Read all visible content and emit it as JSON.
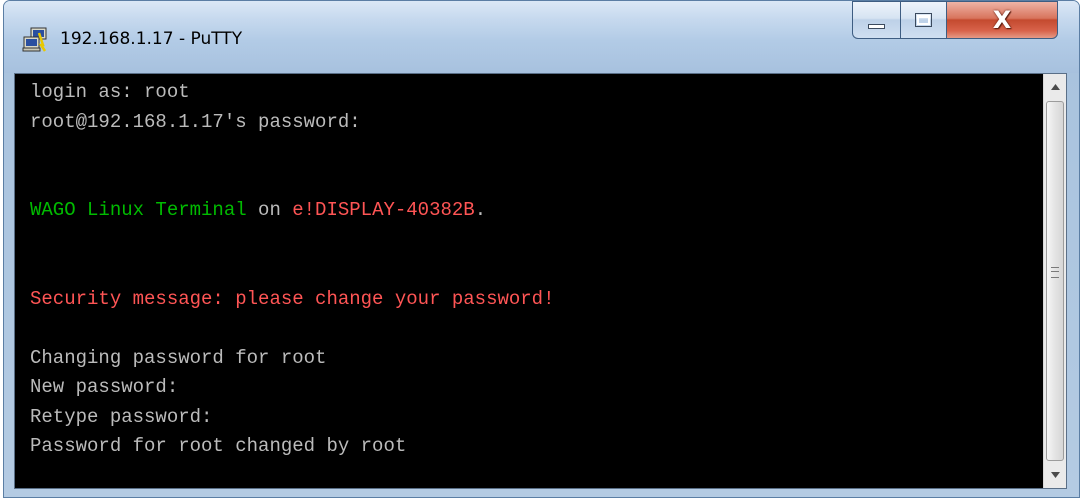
{
  "window": {
    "title": "192.168.1.17 - PuTTY",
    "app_icon": "putty-computers-icon",
    "controls": {
      "minimize_icon": "minimize-icon",
      "maximize_icon": "maximize-icon",
      "close_icon": "close-icon",
      "close_glyph": "X"
    }
  },
  "terminal": {
    "background": "#000000",
    "colors": {
      "default": "#bbbbbb",
      "green": "#00bb00",
      "red": "#ff5555"
    },
    "lines": [
      [
        {
          "text": "login as: root",
          "color": "gray"
        }
      ],
      [
        {
          "text": "root@192.168.1.17's password:",
          "color": "gray"
        }
      ],
      [],
      [],
      [
        {
          "text": "WAGO Linux Terminal",
          "color": "green"
        },
        {
          "text": " on ",
          "color": "gray"
        },
        {
          "text": "e!DISPLAY-40382B",
          "color": "red"
        },
        {
          "text": ".",
          "color": "gray"
        }
      ],
      [],
      [],
      [
        {
          "text": "Security message: please change your password!",
          "color": "red"
        }
      ],
      [],
      [
        {
          "text": "Changing password for root",
          "color": "gray"
        }
      ],
      [
        {
          "text": "New password:",
          "color": "gray"
        }
      ],
      [
        {
          "text": "Retype password:",
          "color": "gray"
        }
      ],
      [
        {
          "text": "Password for root changed by root",
          "color": "gray"
        }
      ]
    ]
  },
  "scrollbar": {
    "up_icon": "scroll-up-arrow-icon",
    "down_icon": "scroll-down-arrow-icon",
    "grip_icon": "grip-lines-icon"
  }
}
